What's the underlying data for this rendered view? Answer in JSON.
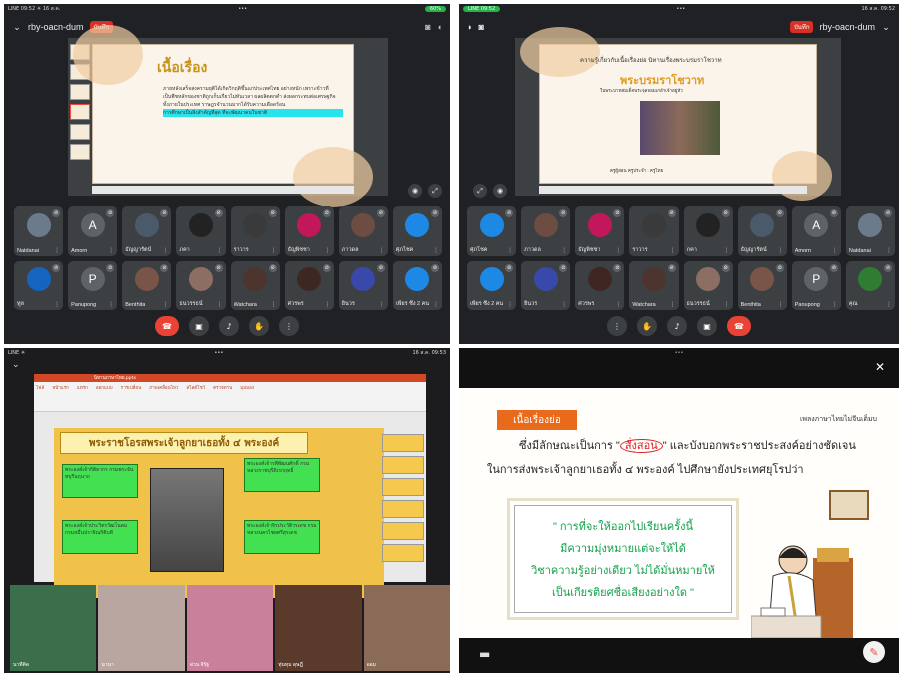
{
  "panel1": {
    "status": {
      "left": "LINE 09:52 ☀ 16 ส.ค.",
      "dots": "•••",
      "right": "60%"
    },
    "meet_code": "rby-oacn-dum",
    "rec_label": "บันทึก",
    "slide_title": "เนื้อเรื่อง",
    "slide_lines": [
      "ภายหลังเสร็จสงครามยุติได้เกิดวิกฤติขึ้นแก่ประเทศไทย อย่างหนัก เพราะข้าวที่",
      "เป็นพืชหลักของชาติถูกเก็บเกี่ยวไม่ทันเวลา ผลผลิตตกต่ำ ส่งผลกระทบต่อเศรษฐกิจ",
      "ทั้งภายในประเทศ ราษฎรจำนวนมากได้รับความเดือดร้อน"
    ],
    "slide_highlight": "การศึกษาเป็นสิ่งสำคัญที่สุด ที่จะพัฒนาคนในชาติ",
    "participants_row1": [
      {
        "name": "Natdanai",
        "initial": "",
        "color": "#6b7b8c"
      },
      {
        "name": "Amorn",
        "initial": "A",
        "color": "#5f6368"
      },
      {
        "name": "ธัญญารัตน์",
        "initial": "",
        "color": "#4a5a6a"
      },
      {
        "name": "ภคา",
        "initial": "",
        "color": "#222"
      },
      {
        "name": "ราวาร",
        "initial": "",
        "color": "#3a3a3a"
      },
      {
        "name": "ธัญพิชชา",
        "initial": "",
        "color": "#c2185b"
      },
      {
        "name": "ภาวดล",
        "initial": "",
        "color": "#6d4c41"
      },
      {
        "name": "ศุภโชค",
        "initial": "",
        "color": "#1e88e5"
      }
    ],
    "participants_row2": [
      {
        "name": "ทูล",
        "initial": "",
        "color": "#1565c0"
      },
      {
        "name": "Panupong",
        "initial": "P",
        "color": "#5f6368"
      },
      {
        "name": "Benthita",
        "initial": "",
        "color": "#795548"
      },
      {
        "name": "ธนวรรธน์",
        "initial": "",
        "color": "#8d6e63"
      },
      {
        "name": "Watchara",
        "initial": "",
        "color": "#4e342e"
      },
      {
        "name": "ศวรพร",
        "initial": "",
        "color": "#3e2723"
      },
      {
        "name": "ยินวร",
        "initial": "",
        "color": "#3949ab"
      },
      {
        "name": "เพียร ซึ่ง 2 คน",
        "initial": "",
        "color": "#1e88e5"
      }
    ]
  },
  "panel2": {
    "status": {
      "left": "LINE 09:52",
      "dots": "•••",
      "right": "16 ส.ค. 09:52"
    },
    "meet_code": "rby-oacn-dum",
    "rec_label": "บันทึก",
    "slide_line1": "ความรู้เกี่ยวกับเนื้อเรื่องย่อ นิทานเรื่องพระบรมราโชวาท",
    "slide_title": "พระบรมราโชวาท",
    "slide_sub": "ในพระบาทสมเด็จพระจุลจอมเกล้าเจ้าอยู่หัว",
    "slide_author": "ครูผู้สอน ครูประจำ : ครูไทย",
    "participants_row1": [
      {
        "name": "ศุภโชค",
        "initial": "",
        "color": "#1e88e5"
      },
      {
        "name": "ภาวดล",
        "initial": "",
        "color": "#6d4c41"
      },
      {
        "name": "ธัญพิชชา",
        "initial": "",
        "color": "#c2185b"
      },
      {
        "name": "ราวาร",
        "initial": "",
        "color": "#3a3a3a"
      },
      {
        "name": "ภคา",
        "initial": "",
        "color": "#222"
      },
      {
        "name": "ธัญญารัตน์",
        "initial": "",
        "color": "#4a5a6a"
      },
      {
        "name": "Amorn",
        "initial": "A",
        "color": "#5f6368"
      },
      {
        "name": "Natdanai",
        "initial": "",
        "color": "#6b7b8c"
      }
    ],
    "participants_row2": [
      {
        "name": "เพียร ซึ่ง 2 คน",
        "initial": "",
        "color": "#1e88e5"
      },
      {
        "name": "ยินวร",
        "initial": "",
        "color": "#3949ab"
      },
      {
        "name": "ศวรพร",
        "initial": "",
        "color": "#3e2723"
      },
      {
        "name": "Watchara",
        "initial": "",
        "color": "#4e342e"
      },
      {
        "name": "ธนวรรธน์",
        "initial": "",
        "color": "#8d6e63"
      },
      {
        "name": "Benthita",
        "initial": "",
        "color": "#795548"
      },
      {
        "name": "Panupong",
        "initial": "P",
        "color": "#5f6368"
      },
      {
        "name": "คุณ",
        "initial": "",
        "color": "#2e7d32"
      }
    ]
  },
  "panel3": {
    "status": {
      "left": "LINE ☀",
      "dots": "•••",
      "right": "16 ส.ค. 09:53"
    },
    "file_title": "นิทานภาษาไทย.pptx",
    "ribbon_tabs": [
      "ไฟล์",
      "หน้าแรก",
      "แทรก",
      "ออกแบบ",
      "การเปลี่ยน",
      "ภาพเคลื่อนไหว",
      "สไลด์โชว์",
      "ตรวจทาน",
      "มุมมอง"
    ],
    "slide_title": "พระราชโอรสพระเจ้าลูกยาเธอทั้ง ๔ พระองค์",
    "box1": "พระองค์เจ้ากิติยากร กรมพระจันทบุรีนฤนาถ",
    "box2": "พระองค์เจ้ารพีพัฒนศักดิ์ กรมหลวงราชบุรีดิเรกฤทธิ์",
    "box3": "พระองค์เจ้าประวิตรวัฒโนดม กรมหมื่นปราจิณกิติบดี",
    "box4": "พระองค์เจ้าจิรประวัติวรเดช กรมหลวงนครไชยศรีสุรเดช",
    "videos": [
      {
        "name": "นาทีคิด",
        "bg": "#3b6e4a"
      },
      {
        "name": "นานา",
        "bg": "#b9a6a1"
      },
      {
        "name": "ด่วน จิรัฐ",
        "bg": "#c9809a"
      },
      {
        "name": "ทุ่นทุม ดุษฎี",
        "bg": "#5a3a2a"
      },
      {
        "name": "ออม",
        "bg": "#8a6b58"
      }
    ]
  },
  "panel4": {
    "tag": "เนื้อเรื่องย่อ",
    "topright": "เพลงภาษาไทยไม่จีนเต็มบ",
    "line1_a": "ซึ่งมีลักษณะเป็นการ \"",
    "line1_circled": "สั่งสอน",
    "line1_b": "\" และบังบอกพระราชประสงค์อย่างชัดเจน",
    "line2": "ในการส่งพระเจ้าลูกยาเธอทั้ง ๔ พระองค์ ไปศึกษายังประเทศยุโรปว่า",
    "quote": [
      "\" การที่จะให้ออกไปเรียนครั้งนี้",
      "มีความมุ่งหมายแต่จะให้ได้",
      "วิชาความรู้อย่างเดียว ไม่ได้มั่นหมายให้",
      "เป็นเกียรติยศชื่อเสียงอย่างใด \""
    ]
  }
}
